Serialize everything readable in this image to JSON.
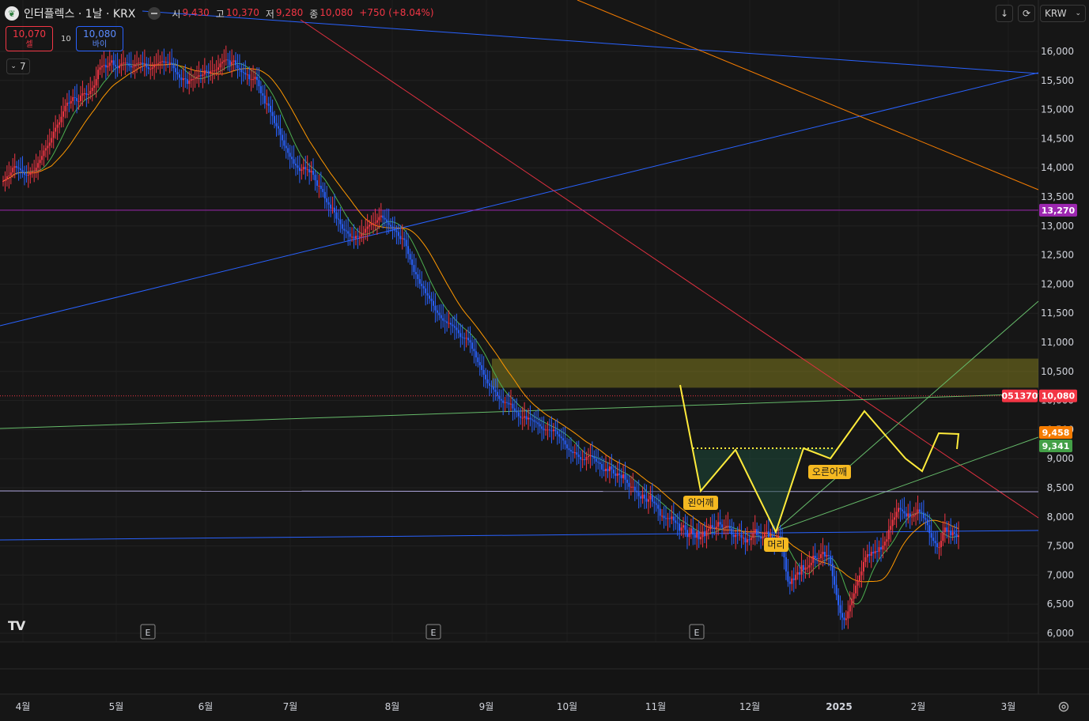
{
  "header": {
    "title": "인터플렉스 · 1날 · KRX",
    "open_label": "시",
    "open": "9,430",
    "high_label": "고",
    "high": "10,370",
    "low_label": "저",
    "low": "9,280",
    "close_label": "종",
    "close": "10,080",
    "change": "+750 (+8.04%)"
  },
  "trade": {
    "sell_price": "10,070",
    "sell_label": "셀",
    "quantity": "10",
    "buy_price": "10,080",
    "buy_label": "바이"
  },
  "indicators_toggle": {
    "count": "7"
  },
  "toolbar": {
    "currency": "KRW"
  },
  "price_axis": {
    "ticks": [
      "16,000",
      "15,500",
      "15,000",
      "14,500",
      "14,000",
      "13,500",
      "13,000",
      "12,500",
      "12,000",
      "11,500",
      "11,000",
      "10,500",
      "10,000",
      "9,500",
      "9,000",
      "8,500",
      "8,000",
      "7,500",
      "7,000",
      "6,500",
      "6,000"
    ]
  },
  "price_labels": {
    "hline": "13,270",
    "symbol_code": "051370",
    "last": "10,080",
    "ma_orange": "9,458",
    "ma_green": "9,341"
  },
  "time_axis": {
    "labels": [
      "4월",
      "5월",
      "6월",
      "7월",
      "8월",
      "9월",
      "10월",
      "11월",
      "12월",
      "2025",
      "2월",
      "3월"
    ]
  },
  "pattern_labels": {
    "left_shoulder": "왼어깨",
    "head": "머리",
    "right_shoulder": "오른어깨"
  },
  "earnings_marker": "E",
  "colors": {
    "background": "#161616",
    "up": "#f23645",
    "down": "#2962ff",
    "ma_short": "#4caf50",
    "ma_long": "#ff9800",
    "hline": "#9c27b0",
    "zone": "#807a1f",
    "pattern": "#ffeb3b"
  },
  "chart_data": {
    "type": "candlestick",
    "y_range": [
      5950,
      16450
    ],
    "last_close": 10080,
    "horizontal_levels": [
      13270,
      8440,
      7760
    ],
    "resistance_zone": [
      10220,
      10720
    ],
    "closes": [
      8.62,
      8.64,
      8.68,
      8.69,
      8.73,
      8.79,
      8.81,
      8.79,
      8.78,
      8.76,
      8.73,
      8.7,
      8.69,
      8.7,
      8.73,
      8.74,
      8.75,
      8.79,
      8.85,
      8.89,
      8.94,
      9.01,
      9.04,
      9.07,
      9.11,
      9.17,
      9.25,
      9.3,
      9.34,
      9.37,
      9.44,
      9.51,
      9.58,
      9.62,
      9.61,
      9.64,
      9.69,
      9.68,
      9.64,
      9.64,
      9.71,
      9.74,
      9.74,
      9.72,
      9.73,
      9.77,
      9.81,
      9.84,
      9.92,
      10.04,
      10.07,
      10.09,
      10.1,
      10.07,
      10.09,
      10.13,
      10.16,
      10.1,
      10.08,
      10.06,
      10.09,
      10.12,
      10.13,
      10.13,
      10.12,
      10.09,
      10.07,
      10.08,
      10.11,
      10.12,
      10.13,
      10.13,
      10.11,
      10.12,
      10.07,
      10.05,
      10.05,
      10.07,
      10.11,
      10.11,
      10.12,
      10.14,
      10.15,
      10.13,
      10.14,
      10.13,
      10.13,
      10.11,
      10.06,
      10.01,
      9.98,
      9.94,
      9.91,
      9.93,
      9.92,
      9.86,
      9.9,
      9.92,
      9.92,
      9.93,
      9.95,
      9.97,
      9.96,
      9.98,
      10.03,
      10.02,
      9.99,
      10.02,
      10.03,
      10.03,
      10.04,
      10.07,
      10.12,
      10.14,
      10.16,
      10.17,
      10.16,
      10.1,
      10.14,
      10.16,
      10.1,
      10.06,
      10.04,
      10.01,
      10.0,
      9.98,
      9.98,
      9.92,
      9.92,
      9.92,
      9.95,
      9.91,
      9.83,
      9.74,
      9.71,
      9.61,
      9.61,
      9.58,
      9.5,
      9.45,
      9.36,
      9.32,
      9.29,
      9.21,
      9.14,
      9.07,
      9.04,
      8.98,
      8.93,
      8.9,
      8.84,
      8.82,
      8.79,
      8.75,
      8.77,
      8.8,
      8.77,
      8.77,
      8.73,
      8.75,
      8.7,
      8.63,
      8.56,
      8.56,
      8.52,
      8.48,
      8.4,
      8.35,
      8.32,
      8.27,
      8.28,
      8.22,
      8.14,
      8.13,
      8.07,
      8.01,
      7.99,
      7.98,
      7.95,
      7.91,
      7.91,
      7.89,
      7.92,
      7.91,
      7.91,
      7.95,
      7.96,
      8.01,
      8.04,
      8.06,
      8.08,
      8.08,
      8.09,
      8.12,
      8.16,
      8.18,
      8.15,
      8.13,
      8.09,
      8.06,
      8.04,
      8.01,
      7.99,
      7.97,
      7.92,
      7.88,
      7.89,
      7.87,
      7.79,
      7.69,
      7.62,
      7.55,
      7.46,
      7.43,
      7.37,
      7.31,
      7.28,
      7.25,
      7.19,
      7.16,
      7.12,
      7.09,
      7.03,
      6.97,
      6.94,
      6.91,
      6.87,
      6.84,
      6.83,
      6.81,
      6.81,
      6.79,
      6.77,
      6.75,
      6.72,
      6.68,
      6.63,
      6.62,
      6.61,
      6.62,
      6.59,
      6.56,
      6.48,
      6.45,
      6.37,
      6.31,
      6.27,
      6.21,
      6.15,
      6.09,
      6.04,
      6.01,
      6.0,
      5.96,
      5.93,
      5.88,
      5.84,
      5.82,
      5.79,
      5.8,
      5.79,
      5.77,
      5.78,
      5.72,
      5.69,
      5.67,
      5.62,
      5.6,
      5.6,
      5.62,
      5.58,
      5.6,
      5.58,
      5.57,
      5.55,
      5.54,
      5.52,
      5.49,
      5.46,
      5.44,
      5.45,
      5.45,
      5.44,
      5.43,
      5.45,
      5.43,
      5.39,
      5.36,
      5.34,
      5.31,
      5.26,
      5.21,
      5.19,
      5.17,
      5.15,
      5.16,
      5.13,
      5.1,
      5.07,
      5.07,
      5.06,
      5.1,
      5.11,
      5.12,
      5.1,
      5.08,
      5.04,
      5.03,
      5.01,
      4.94,
      4.92,
      4.95,
      4.92,
      4.98,
      4.94,
      4.89,
      4.86,
      4.89,
      4.87,
      4.83,
      4.88,
      4.81,
      4.77,
      4.72,
      4.72,
      4.72,
      4.67,
      4.65,
      4.6,
      4.57,
      4.62,
      4.57,
      4.53,
      4.56,
      4.61,
      4.53,
      4.51,
      4.49,
      4.44,
      4.35,
      4.35,
      4.32,
      4.31,
      4.32,
      4.31,
      4.34,
      4.29,
      4.26,
      4.25,
      4.16,
      4.2,
      4.23,
      4.17,
      4.08,
      4.12,
      4.19,
      4.11,
      4.07,
      4.15,
      4.05,
      4.08,
      4.15,
      4.09,
      4.16,
      4.18,
      4.23,
      4.2,
      4.19,
      4.21,
      4.27,
      4.24,
      4.2,
      4.2,
      4.22,
      4.22,
      4.19,
      4.11,
      4.08,
      4.11,
      4.1,
      4.11,
      4.07,
      4.07,
      4.01,
      4.05,
      4.04,
      4.07,
      4.13,
      4.18,
      4.1,
      4.09,
      4.06,
      4.08,
      4.14,
      4.15,
      4.08,
      4.1,
      4.07,
      4.01,
      4.05,
      4.09,
      4.02,
      3.92,
      3.82,
      3.64,
      3.51,
      3.48,
      3.55,
      3.53,
      3.6,
      3.63,
      3.6,
      3.72,
      3.66,
      3.69,
      3.69,
      3.72,
      3.75,
      3.84,
      3.81,
      3.8,
      3.81,
      3.86,
      3.89,
      3.83,
      3.85,
      3.84,
      3.74,
      3.58,
      3.47,
      3.34,
      3.21,
      3.11,
      3.05,
      3.02,
      3.04,
      3.13,
      3.21,
      3.29,
      3.36,
      3.46,
      3.52,
      3.59,
      3.64,
      3.76,
      3.82,
      3.86,
      3.84,
      3.89,
      3.87,
      3.9,
      3.89,
      3.95,
      3.92,
      3.97,
      4.02,
      4.05,
      4.17,
      4.22,
      4.3,
      4.33,
      4.4,
      4.45,
      4.43,
      4.41,
      4.38,
      4.34,
      4.38,
      4.34,
      4.34,
      4.36,
      4.38,
      4.43,
      4.4,
      4.39,
      4.32,
      4.3,
      4.23,
      4.13,
      4.07,
      4.03,
      4.0,
      3.95,
      3.95,
      4.03,
      4.14,
      4.2,
      4.15,
      4.16,
      4.1,
      4.14,
      4.12,
      4.08,
      4.1
    ]
  }
}
